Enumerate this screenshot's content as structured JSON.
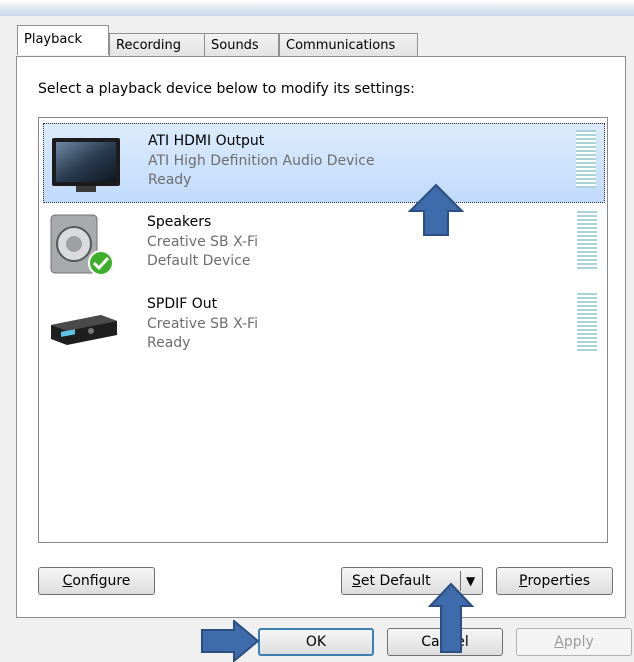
{
  "tabs": [
    {
      "label": "Playback"
    },
    {
      "label": "Recording"
    },
    {
      "label": "Sounds"
    },
    {
      "label": "Communications"
    }
  ],
  "instruction": "Select a playback device below to modify its settings:",
  "devices": [
    {
      "name": "ATI HDMI Output",
      "description": "ATI High Definition Audio Device",
      "status": "Ready",
      "icon": "monitor-icon",
      "selected": true
    },
    {
      "name": "Speakers",
      "description": "Creative SB X-Fi",
      "status": "Default Device",
      "icon": "speaker-icon",
      "selected": false
    },
    {
      "name": "SPDIF Out",
      "description": "Creative SB X-Fi",
      "status": "Ready",
      "icon": "receiver-icon",
      "selected": false
    }
  ],
  "buttons": {
    "configure": {
      "accel": "C",
      "rest": "onfigure"
    },
    "set_default": {
      "accel": "S",
      "rest": "et Default"
    },
    "properties": {
      "accel": "P",
      "rest": "roperties"
    },
    "ok": "OK",
    "cancel": "Cancel",
    "apply": {
      "accel": "A",
      "rest": "pply"
    }
  },
  "colors": {
    "selection": "#c1dbfc",
    "annotation_arrow": "#3e6bab",
    "default_check": "#3fae2a"
  }
}
